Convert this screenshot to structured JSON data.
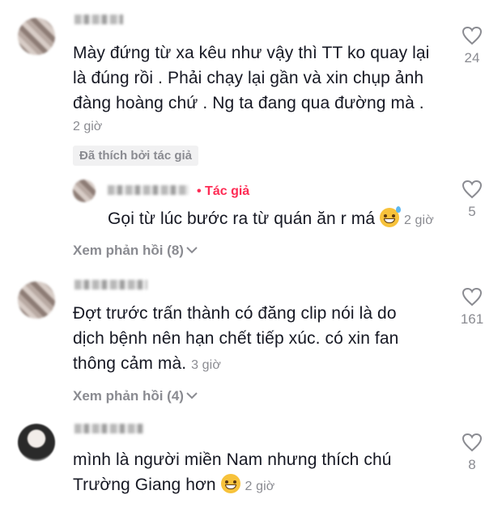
{
  "comments": [
    {
      "text_lines": [
        "Mày đứng từ xa kêu như vậy thì TT ko quay lại",
        "là đúng rồi . Phải chạy lại gần và xin chụp ảnh",
        "đàng hoàng chứ . Ng ta đang qua đường mà ."
      ],
      "time": "2 giờ",
      "likes": "24",
      "badge": "Đã thích bởi tác giả"
    },
    {
      "reply_author_tag": "• Tác giả",
      "text": "Gọi từ lúc bước ra từ quán ăn r má",
      "emoji": "grinning-sweat-emoji",
      "time": "2 giờ",
      "likes": "5"
    },
    {
      "view_replies": "Xem phản hồi (8)"
    },
    {
      "text_lines": [
        "Đợt trước trấn thành có đăng clip nói là do",
        "dịch bệnh nên hạn chết tiếp xúc. có xin fan",
        "thông cảm mà."
      ],
      "time": "3 giờ",
      "likes": "161",
      "view_replies": "Xem phản hồi (4)"
    },
    {
      "text_lines": [
        "mình là người miền Nam nhưng thích chú",
        "Trường Giang hơn"
      ],
      "emoji": "grinning-emoji",
      "time": "2 giờ",
      "likes": "8"
    }
  ],
  "colors": {
    "text": "#161823",
    "secondary": "#8a8b91",
    "author_accent": "#fe2c55"
  }
}
